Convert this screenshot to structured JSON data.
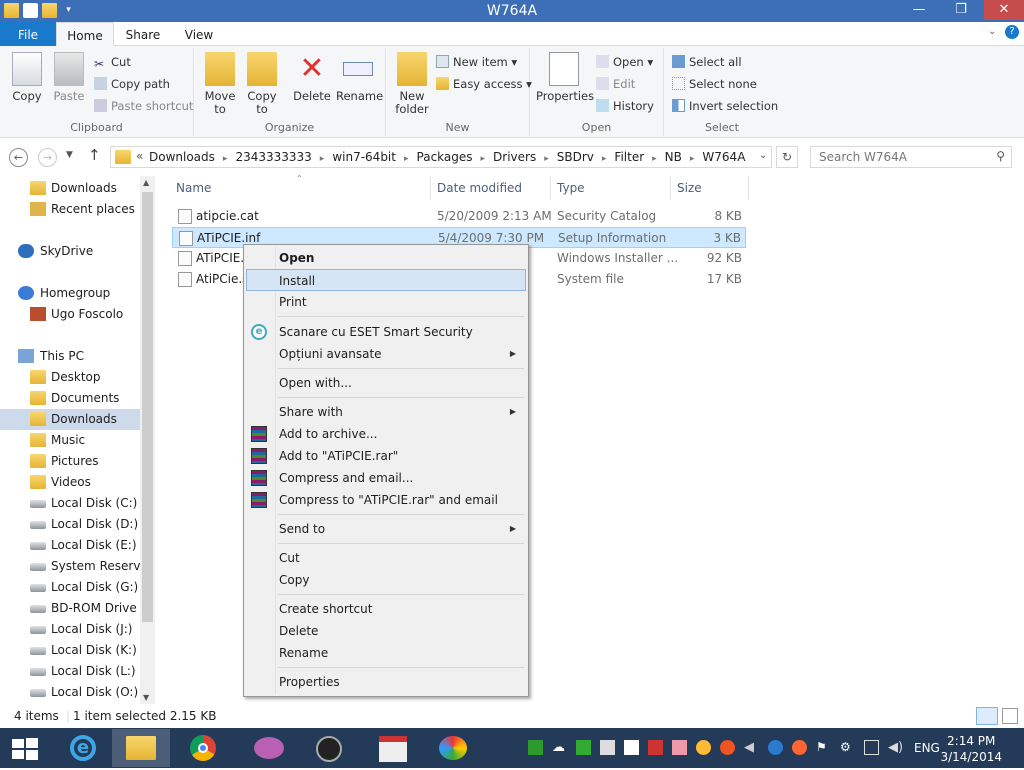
{
  "window": {
    "title": "W764A"
  },
  "tabs": [
    "File",
    "Home",
    "Share",
    "View"
  ],
  "ribbon": {
    "clipboard": {
      "label": "Clipboard",
      "copy": "Copy",
      "paste": "Paste",
      "cut": "Cut",
      "copy_path": "Copy path",
      "paste_shortcut": "Paste shortcut"
    },
    "organize": {
      "label": "Organize",
      "move_to": "Move to",
      "copy_to": "Copy to",
      "delete": "Delete",
      "rename": "Rename"
    },
    "new": {
      "label": "New",
      "new_folder": "New folder",
      "new_item": "New item",
      "easy_access": "Easy access"
    },
    "open": {
      "label": "Open",
      "properties": "Properties",
      "open": "Open",
      "edit": "Edit",
      "history": "History"
    },
    "select": {
      "label": "Select",
      "select_all": "Select all",
      "select_none": "Select none",
      "invert_selection": "Invert selection"
    }
  },
  "address": {
    "crumbs": [
      "Downloads",
      "2343333333",
      "win7-64bit",
      "Packages",
      "Drivers",
      "SBDrv",
      "Filter",
      "NB",
      "W764A"
    ],
    "overflow": "«",
    "search_placeholder": "Search W764A"
  },
  "nav": {
    "items": [
      {
        "label": "Downloads",
        "icon": "folder-icon"
      },
      {
        "label": "Recent places",
        "icon": "recent-places-icon"
      },
      {
        "label": "SkyDrive",
        "icon": "cloud-icon"
      },
      {
        "label": "Homegroup",
        "icon": "homegroup-icon"
      },
      {
        "label": "Ugo Foscolo",
        "icon": "user-avatar-icon"
      },
      {
        "label": "This PC",
        "icon": "computer-icon"
      },
      {
        "label": "Desktop",
        "icon": "folder-icon"
      },
      {
        "label": "Documents",
        "icon": "folder-icon"
      },
      {
        "label": "Downloads",
        "icon": "folder-icon"
      },
      {
        "label": "Music",
        "icon": "folder-icon"
      },
      {
        "label": "Pictures",
        "icon": "folder-icon"
      },
      {
        "label": "Videos",
        "icon": "folder-icon"
      },
      {
        "label": "Local Disk (C:)",
        "icon": "disk-icon"
      },
      {
        "label": "Local Disk (D:)",
        "icon": "windows-disk-icon"
      },
      {
        "label": "Local Disk (E:)",
        "icon": "disk-icon"
      },
      {
        "label": "System Reserved",
        "icon": "disk-icon"
      },
      {
        "label": "Local Disk (G:)",
        "icon": "disk-icon"
      },
      {
        "label": "BD-ROM Drive (I",
        "icon": "bdrom-icon"
      },
      {
        "label": "Local Disk (J:)",
        "icon": "disk-icon"
      },
      {
        "label": "Local Disk (K:)",
        "icon": "disk-icon"
      },
      {
        "label": "Local Disk (L:)",
        "icon": "disk-icon"
      },
      {
        "label": "Local Disk (O:)",
        "icon": "disk-icon"
      }
    ]
  },
  "columns": {
    "name": "Name",
    "date": "Date modified",
    "type": "Type",
    "size": "Size"
  },
  "files": [
    {
      "name": "atipcie.cat",
      "date": "5/20/2009 2:13 AM",
      "type": "Security Catalog",
      "size": "8 KB"
    },
    {
      "name": "ATiPCIE.inf",
      "date": "5/4/2009 7:30 PM",
      "type": "Setup Information",
      "size": "3 KB"
    },
    {
      "name": "ATiPCIE.",
      "date": "M",
      "type": "Windows Installer ...",
      "size": "92 KB"
    },
    {
      "name": "AtiPCie.s",
      "date": "",
      "type": "System file",
      "size": "17 KB"
    }
  ],
  "context_menu": {
    "open": "Open",
    "install": "Install",
    "print": "Print",
    "scan": "Scanare cu ESET Smart Security",
    "advanced": "Opțiuni avansate",
    "open_with": "Open with...",
    "share_with": "Share with",
    "add_archive": "Add to archive...",
    "add_rar": "Add to \"ATiPCIE.rar\"",
    "compress_email": "Compress and email...",
    "compress_rar_email": "Compress to \"ATiPCIE.rar\" and email",
    "send_to": "Send to",
    "cut": "Cut",
    "copy": "Copy",
    "create_shortcut": "Create shortcut",
    "delete": "Delete",
    "rename": "Rename",
    "properties": "Properties"
  },
  "status": {
    "items": "4 items",
    "selected": "1 item selected  2.15 KB"
  },
  "taskbar": {
    "lang": "ENG",
    "time": "2:14 PM",
    "date": "3/14/2014"
  },
  "colors": {
    "accent": "#3c6fb8",
    "file_tab": "#1979ca",
    "taskbar": "#243a59",
    "selection": "#cde8ff"
  }
}
